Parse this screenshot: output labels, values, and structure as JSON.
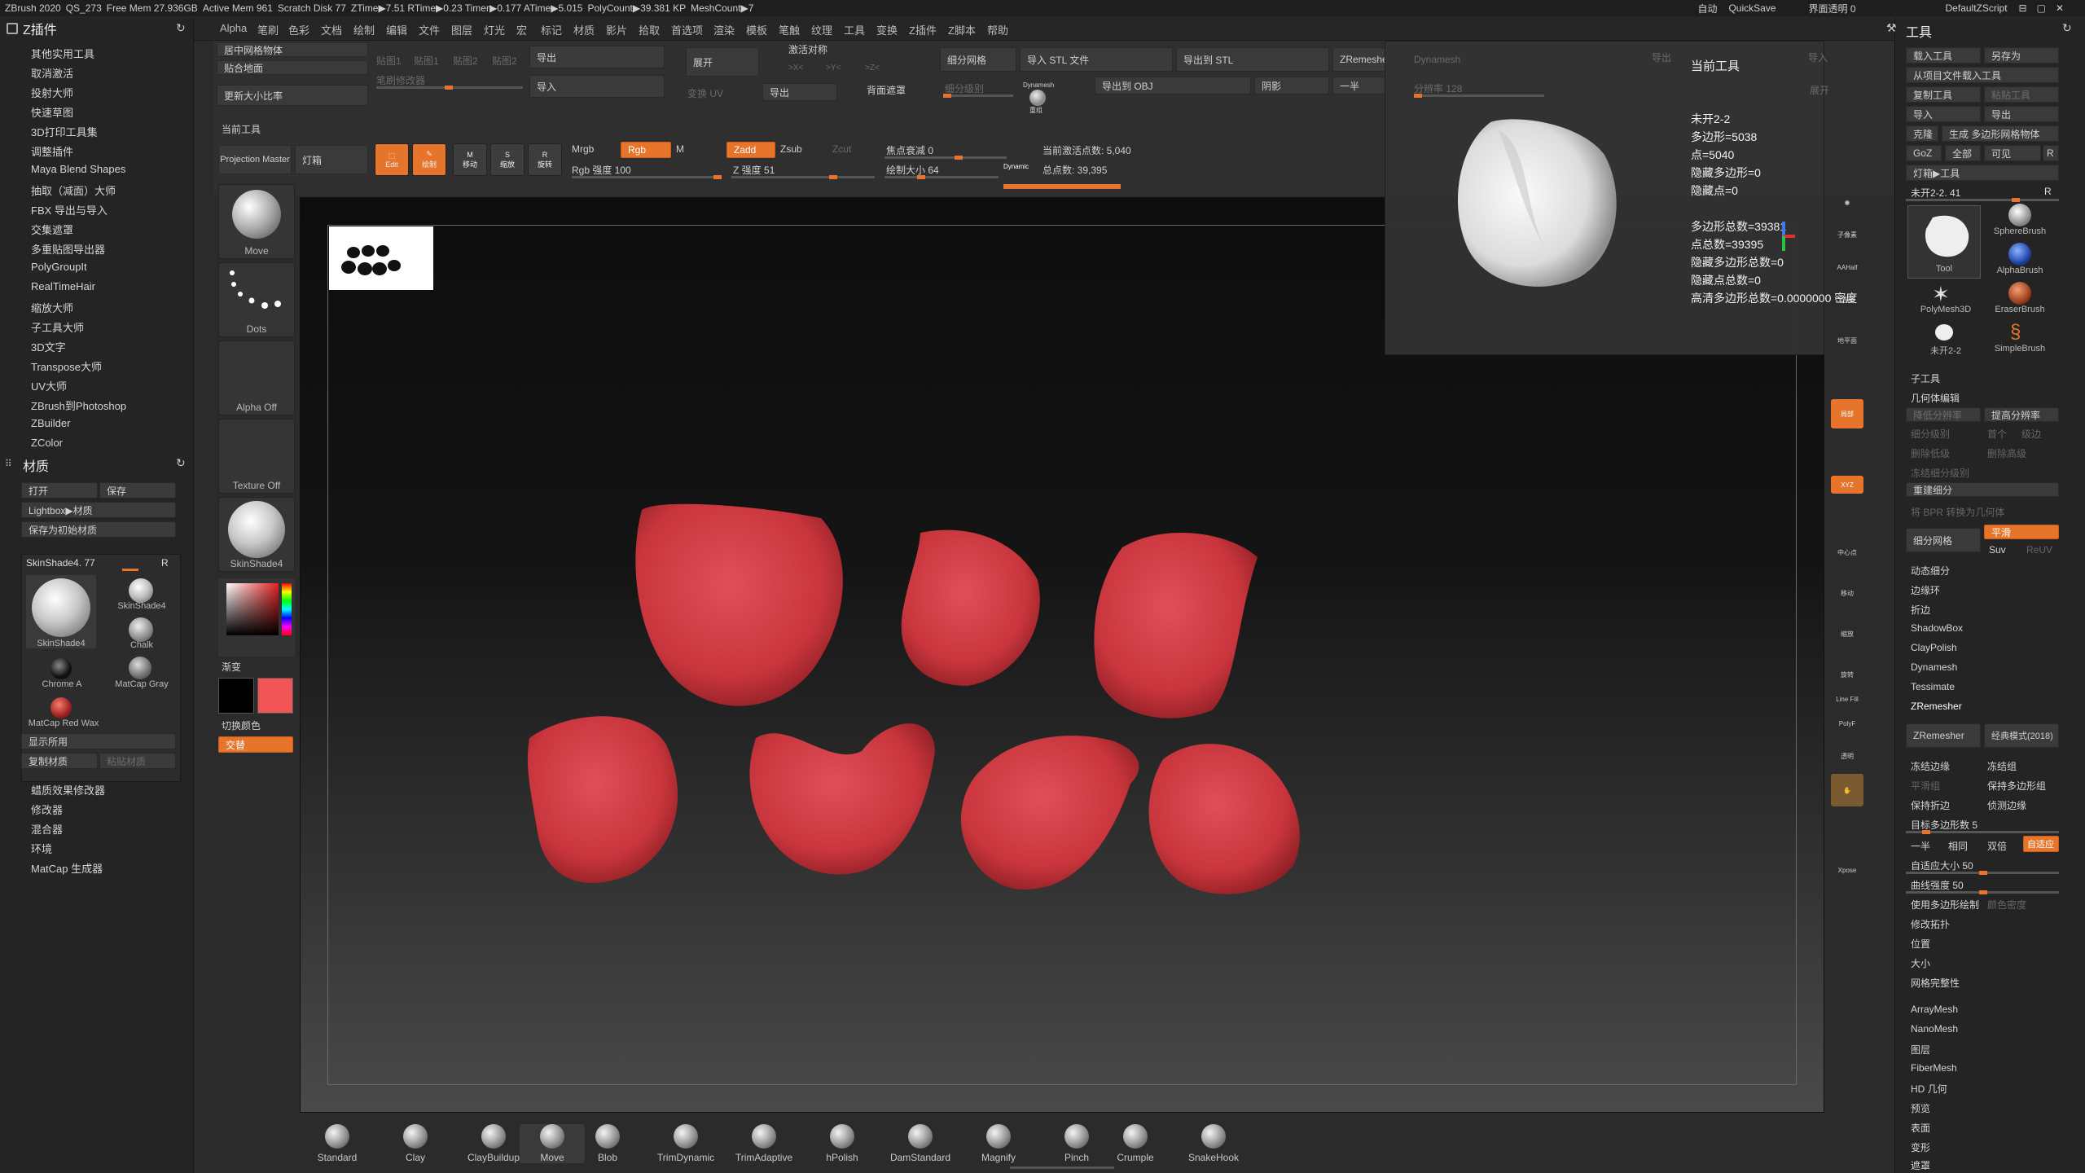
{
  "titlebar": {
    "items": [
      "ZBrush 2020",
      "QS_273",
      "Free Mem 27.936GB",
      "Active Mem 961",
      "Scratch Disk 77",
      "ZTime▶7.51 RTime▶0.23 Timer▶0.177 ATime▶5.015",
      "PolyCount▶39.381 KP",
      "MeshCount▶7"
    ],
    "right": [
      "自动",
      "QuickSave",
      "界面透明 0",
      "DefaultZScript"
    ]
  },
  "menubar": [
    "Alpha",
    "笔刷",
    "色彩",
    "文档",
    "绘制",
    "编辑",
    "文件",
    "图层",
    "灯光",
    "宏",
    "标记",
    "材质",
    "影片",
    "拾取",
    "首选项",
    "渲染",
    "模板",
    "笔触",
    "纹理",
    "工具",
    "变换",
    "Z插件",
    "Z脚本",
    "帮助"
  ],
  "left": {
    "zplugin_title": "Z插件",
    "zplugin_items": [
      "其他实用工具",
      "取消激活",
      "投射大师",
      "快速草图",
      "3D打印工具集",
      "调整插件",
      "Maya Blend Shapes",
      "抽取（减面）大师",
      "FBX 导出与导入",
      "交集遮罩",
      "多重贴图导出器",
      "PolyGroupIt",
      "RealTimeHair",
      "缩放大师",
      "子工具大师",
      "3D文字",
      "Transpose大师",
      "UV大师",
      "ZBrush到Photoshop",
      "ZBuilder",
      "ZColor"
    ],
    "material_title": "材质",
    "material_btns": [
      "打开",
      "保存",
      "Lightbox▶材质",
      "保存为初始材质"
    ],
    "current_material": "SkinShade4. 77",
    "current_material_r": "R",
    "materials": [
      "SkinShade4",
      "SkinShade4",
      "Chalk",
      "Chrome A",
      "MatCap Gray",
      "MatCap Red Wax"
    ],
    "mat_btns": [
      "显示所用",
      "复制材质",
      "粘贴材质"
    ],
    "sub_items": [
      "蜡质效果修改器",
      "修改器",
      "混合器",
      "环境",
      "MatCap 生成器"
    ]
  },
  "tools_col": {
    "items": [
      "Move",
      "Dots",
      "Alpha Off",
      "Texture Off",
      "SkinShade4"
    ],
    "gradient": "渐变",
    "switch_color": "切换颜色",
    "swap": "交替",
    "color_main": "#000000",
    "color_sec": "#f25555"
  },
  "shelf": {
    "current_tool": "当前工具",
    "projection_master": "Projection Master",
    "lightbox": "灯箱",
    "c1": [
      "居中网格物体",
      "贴合地面",
      "更新大小比率"
    ],
    "layers": [
      "贴图1",
      "贴图1",
      "贴图2",
      "贴图2"
    ],
    "mesh_modifier": "笔刷修改器",
    "export": "导出",
    "import": "导入",
    "expand": "展开",
    "activate_sym": "激活对称",
    "sym_axes": [
      ">X<",
      ">Y<",
      ">Z<"
    ],
    "transform_uv": "变换 UV",
    "export2": "导出",
    "backface": "背面遮罩",
    "subdiv": "细分网格",
    "subdiv_level": "细分级别",
    "dynamesh_small": "Dynamesh",
    "dynamesh_small2": "重组",
    "import_stl": "导入 STL 文件",
    "export_stl": "导出到 STL",
    "export_obj": "导出到 OBJ",
    "shadow": "阴影",
    "zremesher": "ZRemesher",
    "half": "一半",
    "draw_btns": [
      "Edit",
      "绘制",
      "移动",
      "缩放",
      "旋转"
    ],
    "mrgb": "Mrgb",
    "rgb": "Rgb",
    "m": "M",
    "rgb_intensity": "Rgb 强度 100",
    "zadd": "Zadd",
    "zsub": "Zsub",
    "zcut": "Zcut",
    "z_intensity": "Z 强度 51",
    "focal": "焦点衰减 0",
    "draw_size": "绘制大小 64",
    "dynamic": "Dynamic",
    "active_points": "当前激活点数: 5,040",
    "total_points": "总点数: 39,395"
  },
  "popup": {
    "dynamesh": "Dynamesh",
    "export": "导出",
    "import": "导入",
    "expand": "展开",
    "resolution": "分辨率 128",
    "title": "当前工具",
    "stats": [
      "未开2-2",
      "多边形=5038",
      "点=5040",
      "隐藏多边形=0",
      "隐藏点=0",
      "多边形总数=39381",
      "点总数=39395",
      "隐藏多边形总数=0",
      "隐藏点总数=0",
      "高清多边形总数=0.0000000 密度"
    ]
  },
  "right_strip": [
    "子像素",
    "AAHalf",
    "透视",
    "地平面",
    "局部",
    "XYZ",
    "中心点",
    "移动",
    "缩放",
    "旋转",
    "Line Fill",
    "PolyF",
    "透明",
    "Xpose"
  ],
  "right": {
    "title": "工具",
    "btns1": [
      "载入工具",
      "另存为",
      "从项目文件载入工具",
      "复制工具",
      "粘贴工具",
      "导入",
      "导出",
      "克隆",
      "生成 多边形网格物体",
      "GoZ",
      "全部",
      "可见",
      "R",
      "灯箱▶工具"
    ],
    "current_tool": "未开2-2. 41",
    "current_tool_r": "R",
    "tools": [
      "Tool",
      "SphereBrush",
      "AlphaBrush",
      "PolyMesh3D",
      "EraserBrush",
      "未开2-2",
      "SimpleBrush"
    ],
    "subtool": "子工具",
    "geom": "几何体编辑",
    "geom_items": [
      "降低分辨率",
      "提高分辨率",
      "细分级别",
      "首个",
      "级边",
      "删除低级",
      "删除高级",
      "冻结细分级别",
      "重建细分",
      "将 BPR 转换为几何体",
      "细分网格",
      "平滑",
      "Suv",
      "ReUV",
      "动态细分",
      "边缘环",
      "折边",
      "ShadowBox",
      "ClayPolish",
      "Dynamesh",
      "Tessimate",
      "ZRemesher",
      "ZRemesher",
      "经典模式(2018)",
      "冻结边缘",
      "冻结组",
      "平滑组",
      "保持多边形组",
      "保持折边",
      "侦测边缘",
      "目标多边形数 5",
      "一半",
      "相同",
      "双倍",
      "自适应",
      "自适应大小 50",
      "曲线强度 50",
      "使用多边形绘制",
      "颜色密度",
      "修改拓扑",
      "位置",
      "大小",
      "网格完整性"
    ],
    "bottom": [
      "ArrayMesh",
      "NanoMesh",
      "图层",
      "FiberMesh",
      "HD 几何",
      "预览",
      "表面",
      "变形",
      "遮罩"
    ]
  },
  "brushes": [
    "Standard",
    "Clay",
    "ClayBuildup",
    "Move",
    "Blob",
    "TrimDynamic",
    "TrimAdaptive",
    "hPolish",
    "DamStandard",
    "Magnify",
    "Pinch",
    "Crumple",
    "SnakeHook"
  ],
  "colors": {
    "accent": "#e6742a",
    "petal": "#c8353c",
    "bg": "#2b2b2b"
  }
}
